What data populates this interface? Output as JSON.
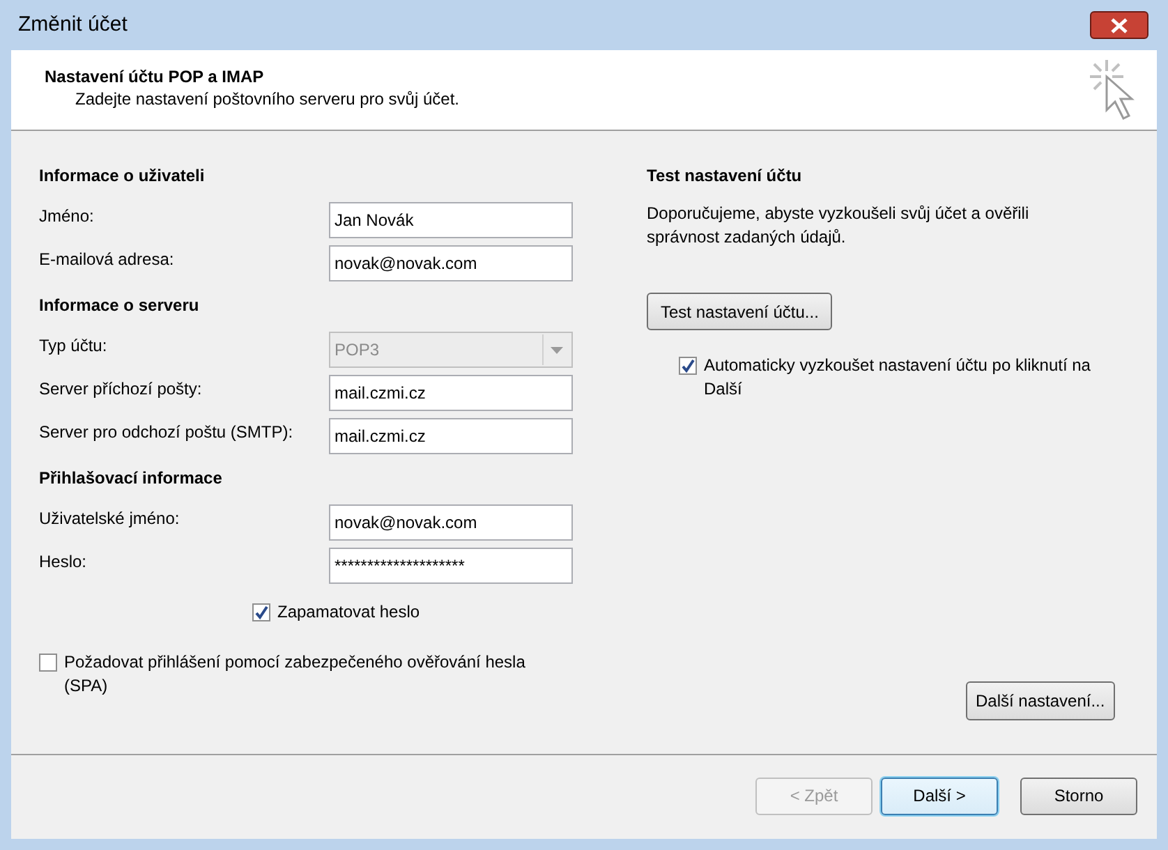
{
  "window": {
    "title": "Změnit účet"
  },
  "header": {
    "title": "Nastavení účtu POP a IMAP",
    "subtitle": "Zadejte nastavení poštovního serveru pro svůj účet."
  },
  "sections": [
    {
      "heading": "Informace o uživateli",
      "fields": [
        {
          "label": "Jméno:",
          "kind": "text",
          "value": "Jan Novák",
          "disabled": false
        },
        {
          "label": "E-mailová adresa:",
          "kind": "text",
          "value": "novak@novak.com",
          "disabled": false
        }
      ]
    },
    {
      "heading": "Informace o serveru",
      "fields": [
        {
          "label": "Typ účtu:",
          "kind": "dropdown",
          "value": "POP3",
          "disabled": true
        },
        {
          "label": "Server příchozí pošty:",
          "kind": "text",
          "value": "mail.czmi.cz",
          "disabled": false
        },
        {
          "label": "Server pro odchozí poštu (SMTP):",
          "kind": "text",
          "value": "mail.czmi.cz",
          "disabled": false
        }
      ]
    },
    {
      "heading": "Přihlašovací informace",
      "fields": [
        {
          "label": "Uživatelské jméno:",
          "kind": "text",
          "value": "novak@novak.com",
          "disabled": false
        },
        {
          "label": "Heslo:",
          "kind": "password",
          "value": "********************",
          "disabled": false
        }
      ]
    }
  ],
  "remember_password": {
    "label": "Zapamatovat heslo",
    "checked": true
  },
  "spa": {
    "label": "Požadovat přihlášení pomocí zabezpečeného ověřování hesla (SPA)",
    "checked": false
  },
  "test": {
    "heading": "Test nastavení účtu",
    "text": "Doporučujeme, abyste vyzkoušeli svůj účet a ověřili správnost zadaných údajů.",
    "button": "Test nastavení účtu...",
    "auto_test": {
      "label": "Automaticky vyzkoušet nastavení účtu po kliknutí na Další",
      "checked": true
    }
  },
  "more_settings_button": "Další nastavení...",
  "footer_buttons": [
    {
      "label": "< Zpět",
      "disabled": true,
      "default": false
    },
    {
      "label": "Další >",
      "disabled": false,
      "default": true
    },
    {
      "label": "Storno",
      "disabled": false,
      "default": false
    }
  ]
}
